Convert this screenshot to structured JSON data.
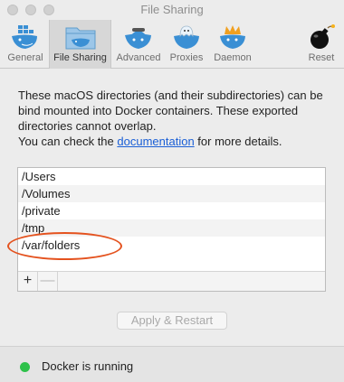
{
  "window": {
    "title": "File Sharing"
  },
  "toolbar": {
    "items": [
      {
        "label": "General",
        "icon": "whale-icon"
      },
      {
        "label": "File Sharing",
        "icon": "whale-folder-icon",
        "active": true
      },
      {
        "label": "Advanced",
        "icon": "whale-icon"
      },
      {
        "label": "Proxies",
        "icon": "whale-icon"
      },
      {
        "label": "Daemon",
        "icon": "whale-icon"
      },
      {
        "label": "Reset",
        "icon": "bomb-icon"
      }
    ]
  },
  "description": {
    "text": "These macOS directories (and their subdirectories) can be bind mounted into Docker containers. These exported directories cannot overlap.",
    "help_prefix": "You can check the ",
    "help_link": "documentation",
    "help_suffix": " for more details."
  },
  "directories": [
    "/Users",
    "/Volumes",
    "/private",
    "/tmp",
    "/var/folders"
  ],
  "list_controls": {
    "add": "+",
    "remove": "—"
  },
  "apply_button": "Apply & Restart",
  "status": {
    "text": "Docker is running",
    "color": "#2ec14a"
  },
  "annotation_color": "#e4521e"
}
